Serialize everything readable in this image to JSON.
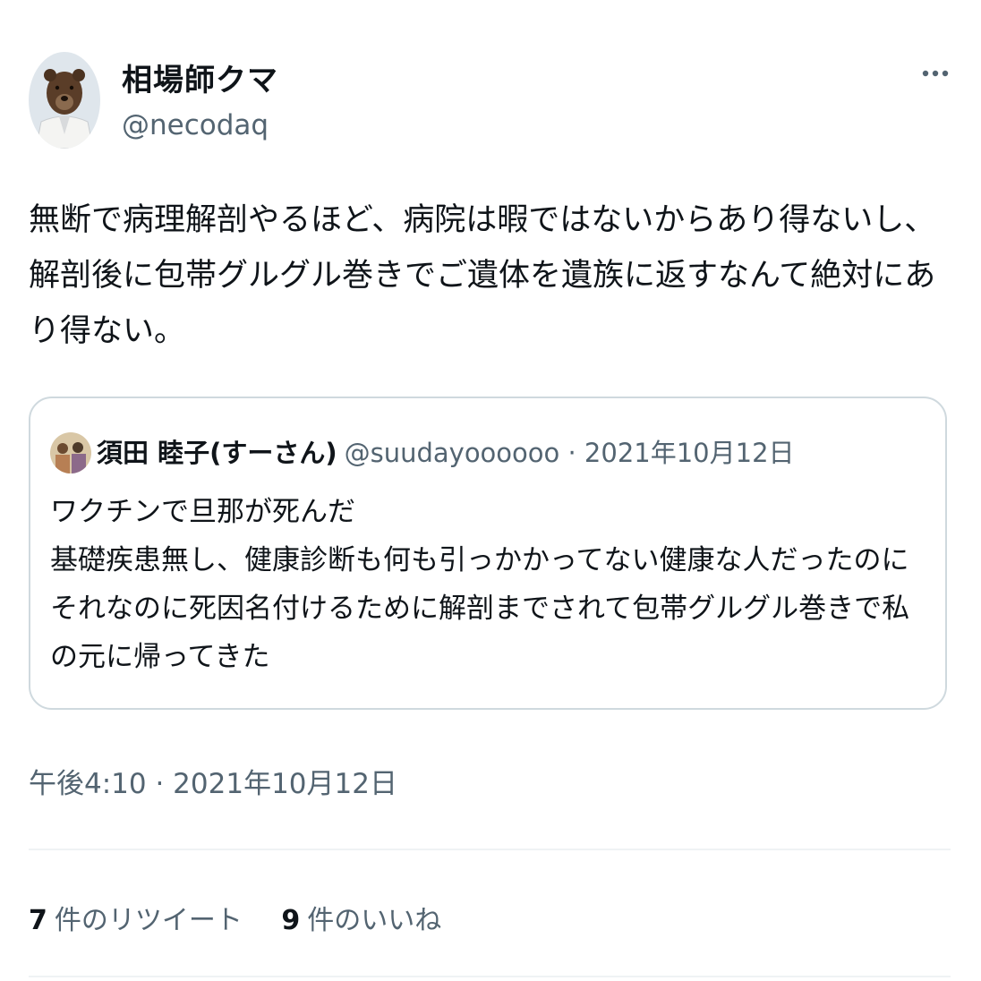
{
  "tweet": {
    "author": {
      "display_name": "相場師クマ",
      "handle": "@necodaq",
      "avatar_icon": "bear-avatar-icon"
    },
    "more_icon": "more-horizontal-icon",
    "text_lines": [
      "無断で病理解剖やるほど、病院は暇ではないからあり得ないし、",
      "解剖後に包帯グルグル巻きでご遺体を遺族に返すなんて絶対にあ",
      "り得ない。"
    ],
    "quoted": {
      "display_name": "須田 睦子(すーさん)",
      "meta": "@suudayoooooo · 2021年10月12日",
      "text_lines": [
        "ワクチンで旦那が死んだ",
        "基礎疾患無し、健康診断も何も引っかかってない健康な人だったのに",
        "それなのに死因名付けるために解剖までされて包帯グルグル巻きで私",
        "の元に帰ってきた"
      ]
    },
    "timestamp": "午後4:10 · 2021年10月12日",
    "stats": {
      "retweets_count": "7",
      "retweets_label": "件のリツイート",
      "likes_count": "9",
      "likes_label": "件のいいね"
    }
  },
  "colors": {
    "text": "#0f1419",
    "secondary": "#536471",
    "border": "#cfd9de",
    "divider": "#eff3f4"
  }
}
